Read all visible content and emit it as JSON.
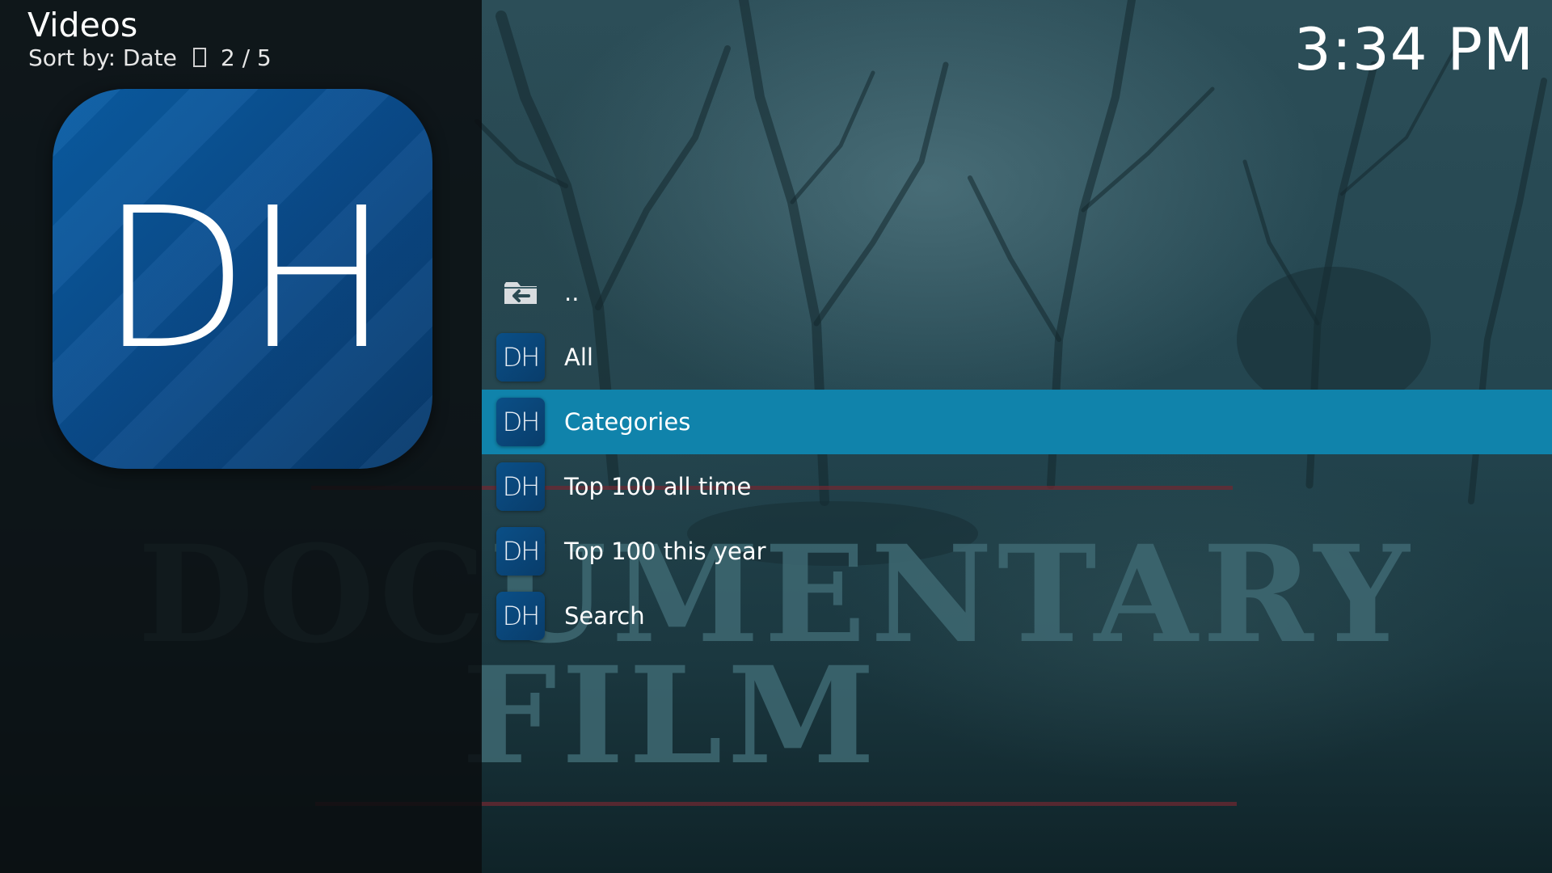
{
  "header": {
    "window_title": "Videos",
    "sort_label": "Sort by: Date",
    "sort_icon": "sort-order-icon",
    "position": "2 / 5",
    "clock": "3:34 PM"
  },
  "addon": {
    "thumb_text": "DH"
  },
  "fanart": {
    "title_line1": "DOCUMENTARY",
    "title_line2": "FILM"
  },
  "list": {
    "focused_index": 2,
    "items": [
      {
        "label": "..",
        "icon": "folder-back-icon",
        "icon_text": ""
      },
      {
        "label": "All",
        "icon": "dh-addon-icon",
        "icon_text": "DH"
      },
      {
        "label": "Categories",
        "icon": "dh-addon-icon",
        "icon_text": "DH"
      },
      {
        "label": "Top 100 all time",
        "icon": "dh-addon-icon",
        "icon_text": "DH"
      },
      {
        "label": "Top 100 this year",
        "icon": "dh-addon-icon",
        "icon_text": "DH"
      },
      {
        "label": "Search",
        "icon": "dh-addon-icon",
        "icon_text": "DH"
      }
    ]
  },
  "colors": {
    "focus_bar": "#1083ab",
    "addon_blue": "#0b4c8c",
    "rule_red": "#6e2832"
  }
}
